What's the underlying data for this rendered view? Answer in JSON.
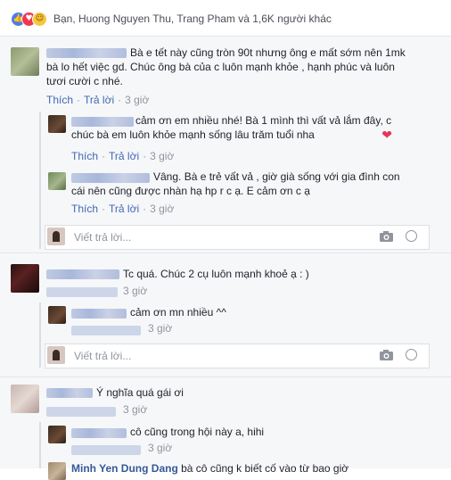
{
  "reactions": {
    "icons": [
      "like-icon",
      "love-icon",
      "haha-icon"
    ],
    "text": "Bạn, Huong Nguyen Thu, Trang Pham và 1,6K người khác"
  },
  "labels": {
    "like": "Thích",
    "reply": "Trả lời",
    "reply_placeholder": "Viết trả lời..."
  },
  "comments": [
    {
      "text": "Bà e tết này cũng tròn 90t nhưng ông e mất sớm nên 1mk bà lo hết việc gd. Chúc ông bà của c luôn mạnh khỏe , hạnh phúc và luôn tươi cười c nhé.",
      "time": "3 giờ",
      "replies": [
        {
          "text": "cảm ơn em nhiều nhé! Bà 1 mình thì vất vả lắm đây, c chúc bà em luôn khỏe mạnh sống lâu trăm tuổi nha",
          "time": "3 giờ"
        },
        {
          "text": "Vâng. Bà e trẻ vất vả , giờ già sống với gia đình con cái nên cũng được nhàn hạ hp r c ạ. E cảm ơn c ạ",
          "time": "3 giờ"
        }
      ]
    },
    {
      "text": "Tc quá. Chúc 2 cụ luôn mạnh khoẻ ạ : )",
      "time": "3 giờ",
      "replies": [
        {
          "text": "cảm ơn mn nhiều ^^",
          "time": "3 giờ"
        }
      ]
    },
    {
      "text": "Ý nghĩa quá gái ơi",
      "time": "3 giờ",
      "replies": [
        {
          "text": "cô cũng trong hội này a, hihi",
          "time": "3 giờ"
        },
        {
          "name": "Minh Yen Dung Dang",
          "text": "bà cô cũng k biết cố vào từ bao giờ"
        }
      ]
    }
  ],
  "colors": {
    "link": "#4267b2",
    "meta": "#90949c",
    "heart": "#e3365c"
  }
}
